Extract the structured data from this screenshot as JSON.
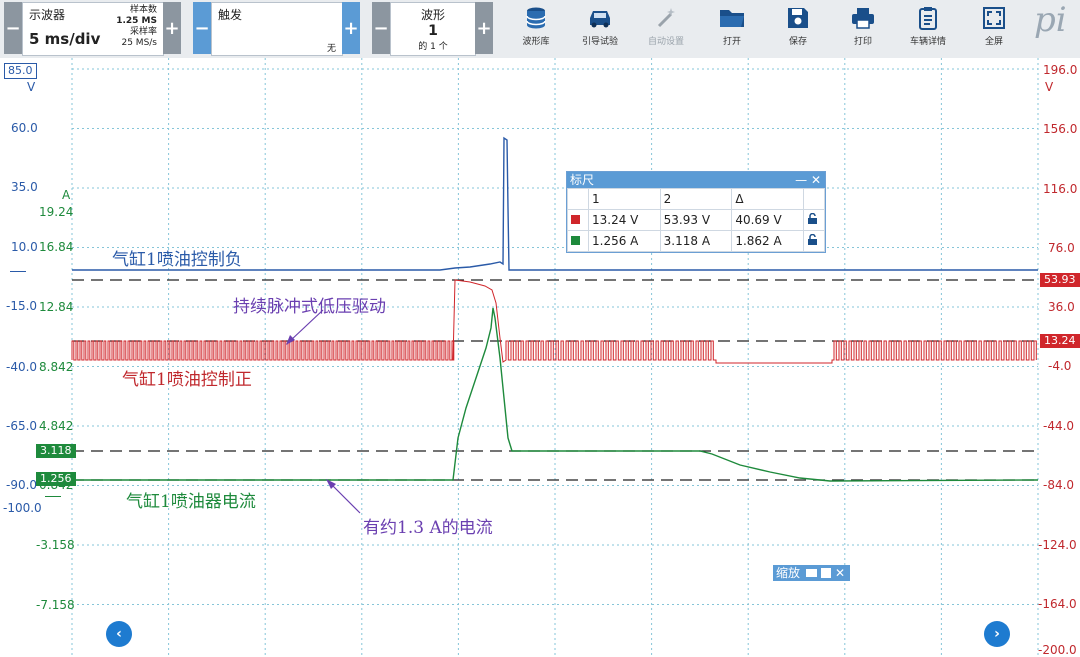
{
  "toolbar": {
    "scope": {
      "title": "示波器",
      "timebase": "5 ms/div",
      "samples_label": "样本数",
      "samples_value": "1.25 MS",
      "rate_label": "采样率",
      "rate_value": "25 MS/s"
    },
    "trigger": {
      "title": "触发",
      "mode": "无"
    },
    "waveform": {
      "title": "波形",
      "number": "1",
      "of_text": "的 1 个"
    },
    "buttons": [
      {
        "id": "library",
        "label": "波形库",
        "icon": "database-icon"
      },
      {
        "id": "guided",
        "label": "引导试验",
        "icon": "car-icon"
      },
      {
        "id": "autoset",
        "label": "自动设置",
        "icon": "wand-icon",
        "disabled": true
      },
      {
        "id": "open",
        "label": "打开",
        "icon": "folder-icon"
      },
      {
        "id": "save",
        "label": "保存",
        "icon": "save-icon"
      },
      {
        "id": "print",
        "label": "打印",
        "icon": "print-icon"
      },
      {
        "id": "vehicle",
        "label": "车辆详情",
        "icon": "clipboard-icon"
      },
      {
        "id": "fullscreen",
        "label": "全屏",
        "icon": "fullscreen-icon"
      }
    ],
    "logo": "pi"
  },
  "scope": {
    "left_axis_blue": {
      "top": "85.0",
      "unit": "V",
      "ticks": [
        "60.0",
        "35.0",
        "10.0",
        "-15.0",
        "-40.0",
        "-65.0",
        "-90.0",
        "-100.0"
      ]
    },
    "left_axis_green": {
      "unit": "A",
      "ticks": [
        "19.24",
        "16.84",
        "12.84",
        "8.842",
        "4.842",
        "0.842",
        "-3.158",
        "-7.158"
      ]
    },
    "right_axis_red": {
      "unit": "V",
      "ticks": [
        "196.0",
        "156.0",
        "116.0",
        "76.0",
        "36.0",
        "-4.0",
        "-44.0",
        "-84.0",
        "-124.0",
        "-164.0",
        "-200.0"
      ]
    },
    "markers": {
      "red_upper": "53.93",
      "red_lower": "13.24",
      "green_upper": "3.118",
      "green_lower": "1.256"
    },
    "annotations": {
      "blue_trace": "气缸1喷油控制负",
      "pulse": "持续脉冲式低压驱动",
      "red_trace": "气缸1喷油控制正",
      "green_trace": "气缸1喷油器电流",
      "current_note": "有约1.3 A的电流"
    },
    "colors": {
      "blue": "#2a5aa8",
      "red": "#d0262b",
      "green": "#1e8a3c",
      "accent": "#5b9bd5"
    }
  },
  "ruler": {
    "title": "标尺",
    "headers": [
      "",
      "1",
      "2",
      "Δ",
      ""
    ],
    "rows": [
      {
        "color": "red",
        "c1": "13.24 V",
        "c2": "53.93 V",
        "delta": "40.69 V"
      },
      {
        "color": "green",
        "c1": "1.256 A",
        "c2": "3.118 A",
        "delta": "1.862 A"
      }
    ]
  },
  "zoom": {
    "title": "缩放"
  }
}
